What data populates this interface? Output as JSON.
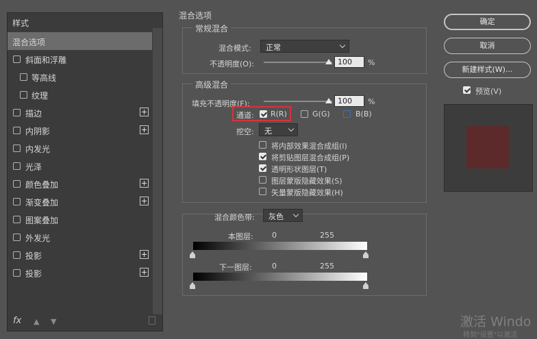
{
  "left_panel": {
    "header": "样式",
    "items": [
      {
        "label": "混合选项",
        "checkbox": false,
        "plus": false,
        "selected": true
      },
      {
        "label": "斜面和浮雕",
        "checkbox": true,
        "plus": false
      },
      {
        "label": "等高线",
        "checkbox": true,
        "plus": false,
        "indent": true
      },
      {
        "label": "纹理",
        "checkbox": true,
        "plus": false,
        "indent": true
      },
      {
        "label": "描边",
        "checkbox": true,
        "plus": true
      },
      {
        "label": "内阴影",
        "checkbox": true,
        "plus": true
      },
      {
        "label": "内发光",
        "checkbox": true,
        "plus": false
      },
      {
        "label": "光泽",
        "checkbox": true,
        "plus": false
      },
      {
        "label": "颜色叠加",
        "checkbox": true,
        "plus": true
      },
      {
        "label": "渐变叠加",
        "checkbox": true,
        "plus": true
      },
      {
        "label": "图案叠加",
        "checkbox": true,
        "plus": false
      },
      {
        "label": "外发光",
        "checkbox": true,
        "plus": false
      },
      {
        "label": "投影",
        "checkbox": true,
        "plus": true
      },
      {
        "label": "投影",
        "checkbox": true,
        "plus": true
      }
    ],
    "footer": {
      "fx": "fx"
    }
  },
  "blend": {
    "title": "混合选项",
    "general": {
      "title": "常规混合",
      "mode_label": "混合模式:",
      "mode_value": "正常",
      "opacity_label": "不透明度(O):",
      "opacity_value": "100",
      "opacity_unit": "%",
      "opacity_level": 100
    },
    "advanced": {
      "title": "高级混合",
      "fill_label": "填充不透明度(F):",
      "fill_value": "100",
      "fill_unit": "%",
      "fill_level": 100,
      "channels_label": "通道:",
      "ch_r": "R(R)",
      "ch_g": "G(G)",
      "ch_b": "B(B)",
      "knockout_label": "挖空:",
      "knockout_value": "无",
      "options": [
        {
          "label": "将内部效果混合成组(I)",
          "checked": false
        },
        {
          "label": "将剪贴图层混合成组(P)",
          "checked": true
        },
        {
          "label": "透明形状图层(T)",
          "checked": true
        },
        {
          "label": "图层蒙版隐藏效果(S)",
          "checked": false
        },
        {
          "label": "矢量蒙版隐藏效果(H)",
          "checked": false
        }
      ]
    },
    "blend_if": {
      "label": "混合颜色带:",
      "value": "灰色",
      "this_layer": "本图层:",
      "this_min": "0",
      "this_max": "255",
      "under_layer": "下一图层:",
      "under_min": "0",
      "under_max": "255"
    }
  },
  "buttons": {
    "ok": "确定",
    "cancel": "取消",
    "new_style": "新建样式(W)...",
    "preview_label": "预览(V)"
  },
  "preview": {
    "swatch_color": "#5c2a2a"
  },
  "watermark": {
    "line1": "激活 Windo",
    "line2": "转到\"设置\"以激活"
  }
}
